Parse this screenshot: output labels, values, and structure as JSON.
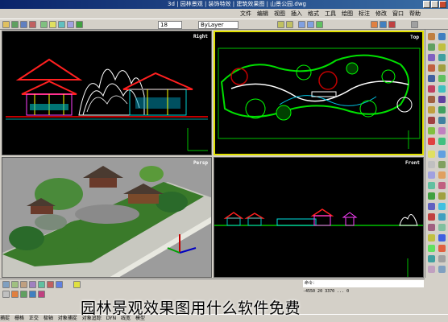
{
  "window": {
    "title": "3d | 园林景观 | 装饰特效 | 建筑效果图 | 山景公园.dwg"
  },
  "menu": [
    "文件",
    "编辑",
    "视图",
    "插入",
    "格式",
    "工具",
    "绘图",
    "标注",
    "修改",
    "窗口",
    "帮助"
  ],
  "toolbar": {
    "layer_value": "18",
    "linetype_value": "ByLayer"
  },
  "viewports": {
    "right": "Right",
    "top": "Top",
    "persp": "Persp",
    "front": "Front"
  },
  "command": {
    "line": "命令：",
    "coords": "-4550 20 3370 ... 0"
  },
  "status": {
    "items": [
      "捕捉",
      "栅格",
      "正交",
      "极轴",
      "对象捕捉",
      "对象追踪",
      "DYN",
      "线宽",
      "模型"
    ]
  },
  "caption": "园林景观效果图用什么软件免费",
  "colors": {
    "viewport_bg": "#000000",
    "ui_gray": "#d4d0c8",
    "accent_green": "#00c000"
  }
}
